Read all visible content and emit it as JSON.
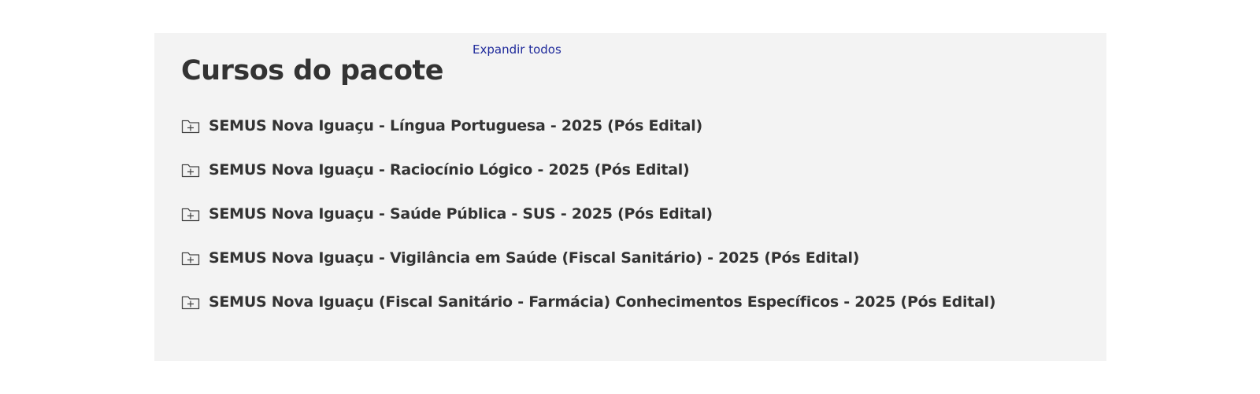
{
  "section": {
    "title": "Cursos do pacote",
    "expand_all_label": "Expandir todos"
  },
  "courses": [
    {
      "label": "SEMUS Nova Iguaçu - Língua Portuguesa - 2025 (Pós Edital)",
      "icon": "folder-plus-icon"
    },
    {
      "label": "SEMUS Nova Iguaçu - Raciocínio Lógico - 2025 (Pós Edital)",
      "icon": "folder-plus-icon"
    },
    {
      "label": "SEMUS Nova Iguaçu - Saúde Pública - SUS - 2025 (Pós Edital)",
      "icon": "folder-plus-icon"
    },
    {
      "label": "SEMUS Nova Iguaçu - Vigilância em Saúde (Fiscal Sanitário) - 2025 (Pós Edital)",
      "icon": "folder-plus-icon"
    },
    {
      "label": "SEMUS Nova Iguaçu (Fiscal Sanitário - Farmácia) Conhecimentos Específicos - 2025 (Pós Edital)",
      "icon": "folder-plus-icon"
    }
  ],
  "colors": {
    "panel_background": "#f3f3f3",
    "text": "#333333",
    "link": "#1f2a9b"
  }
}
